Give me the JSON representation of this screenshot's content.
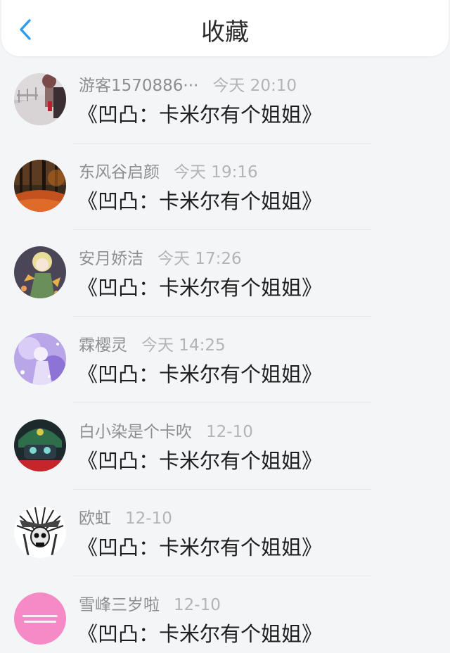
{
  "header": {
    "title": "收藏",
    "back_icon": "chevron-left-icon",
    "accent_color": "#2f9bf0"
  },
  "favorites": [
    {
      "user": "游客1570886···",
      "time": "今天 20:10",
      "content": "《凹凸：卡米尔有个姐姐》",
      "avatar": "street-scene-avatar"
    },
    {
      "user": "东风谷启颜",
      "time": "今天 19:16",
      "content": "《凹凸：卡米尔有个姐姐》",
      "avatar": "autumn-forest-avatar"
    },
    {
      "user": "安月娇洁",
      "time": "今天 17:26",
      "content": "《凹凸：卡米尔有个姐姐》",
      "avatar": "anime-girl-avatar"
    },
    {
      "user": "霖樱灵",
      "time": "今天 14:25",
      "content": "《凹凸：卡米尔有个姐姐》",
      "avatar": "purple-anime-avatar"
    },
    {
      "user": "白小染是个卡吹",
      "time": "12-10",
      "content": "《凹凸：卡米尔有个姐姐》",
      "avatar": "green-hair-anime-avatar"
    },
    {
      "user": "欧虹",
      "time": "12-10",
      "content": "《凹凸：卡米尔有个姐姐》",
      "avatar": "skull-headdress-avatar"
    },
    {
      "user": "雪峰三岁啦",
      "time": "12-10",
      "content": "《凹凸：卡米尔有个姐姐》",
      "avatar": "pink-text-avatar"
    }
  ]
}
